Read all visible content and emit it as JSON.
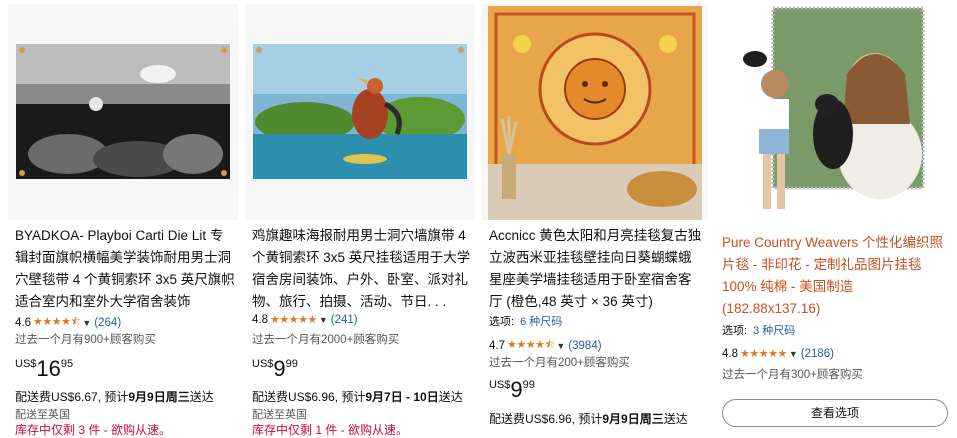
{
  "products": [
    {
      "title": "BYADKOA- Playboi Carti Die Lit 专辑封面旗帜横幅美学装饰耐用男士洞穴壁毯带 4 个黄铜索环 3x5 英尺旗帜适合室内和室外大学宿舍装饰",
      "rating": "4.6",
      "stars": "★★★★⯪",
      "reviews": "(264)",
      "bought": "过去一个月有900+顾客购买",
      "currency": "US$",
      "price_whole": "16",
      "price_frac": "95",
      "shipping_prefix": "配送费US$6.67, 预计",
      "shipping_date": "9月9日周三",
      "shipping_suffix": "送达",
      "ships_from": "配送至英国",
      "stock": "库存中仅剩 3 件 - 欲购从速。"
    },
    {
      "title": "鸡旗趣味海报耐用男士洞穴墙旗带 4 个黄铜索环 3x5 英尺挂毯适用于大学宿舍房间装饰、户外、卧室、派对礼物、旅行、拍摄、活动、节日. . .",
      "rating": "4.8",
      "stars": "★★★★★",
      "reviews": "(241)",
      "bought": "过去一个月有2000+顾客购买",
      "currency": "US$",
      "price_whole": "9",
      "price_frac": "99",
      "shipping_prefix": "配送费US$6.96, 预计",
      "shipping_date": "9月7日 - 10日",
      "shipping_suffix": "送达",
      "ships_from": "配送至英国",
      "stock": "库存中仅剩 1 件 - 欲购从速。"
    },
    {
      "title": "Accnicc 黄色太阳和月亮挂毯复古独立波西米亚挂毯壁挂向日葵蝴蝶蛾星座美学墙挂毯适用于卧室宿舍客厅 (橙色,48 英寸 × 36 英寸)",
      "options_label": "选项:",
      "options_link": "6 种尺码",
      "rating": "4.7",
      "stars": "★★★★⯪",
      "reviews": "(3984)",
      "bought": "过去一个月有200+顾客购买",
      "currency": "US$",
      "price_whole": "9",
      "price_frac": "99",
      "shipping_prefix": "配送费US$6.96, 预计",
      "shipping_date": "9月9日周三",
      "shipping_suffix": "送达"
    },
    {
      "title": "Pure Country Weavers 个性化编织照片毯 - 非印花 - 定制礼品图片挂毯 100% 纯棉 - 美国制造 (182.88x137.16)",
      "options_label": "选项:",
      "options_link": "3 种尺码",
      "rating": "4.8",
      "stars": "★★★★★",
      "reviews": "(2186)",
      "bought": "过去一个月有300+顾客购买",
      "button": "查看选项"
    }
  ],
  "colors": {
    "star": "#de7921",
    "link": "#2162a1",
    "title_link": "#c7511f",
    "stock": "#cc0c39"
  }
}
